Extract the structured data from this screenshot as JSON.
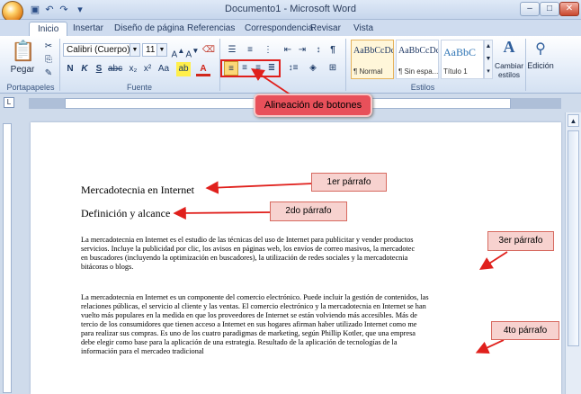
{
  "window": {
    "title": "Documento1 - Microsoft Word"
  },
  "tabs": [
    "Inicio",
    "Insertar",
    "Diseño de página",
    "Referencias",
    "Correspondencia",
    "Revisar",
    "Vista"
  ],
  "ribbon": {
    "clipboard": {
      "label": "Portapapeles",
      "paste_label": "Pegar"
    },
    "font": {
      "label": "Fuente",
      "font_name": "Calibri (Cuerpo)",
      "font_size": "11"
    },
    "paragraph": {
      "label": ""
    },
    "styles": {
      "label": "Estilos",
      "items": [
        {
          "preview": "AaBbCcDc",
          "name": "¶ Normal"
        },
        {
          "preview": "AaBbCcDc",
          "name": "¶ Sin espa..."
        },
        {
          "preview": "AaBbC",
          "name": "Título 1"
        }
      ],
      "change_styles_label": "Cambiar estilos",
      "editing_label": "Edición"
    }
  },
  "annotations": {
    "alignment": "Alineación de botones",
    "p1": "1er párrafo",
    "p2": "2do párrafo",
    "p3": "3er párrafo",
    "p4": "4to párrafo"
  },
  "document": {
    "heading1": "Mercadotecnia en Internet",
    "heading2": "Definición y alcance",
    "para3_lines": [
      "La mercadotecnia en Internet es el estudio de las técnicas del uso de Internet para publicitar y vender productos",
      "servicios. Incluye la publicidad por clic, los avisos en páginas web, los envíos de correo masivos, la mercadotec",
      "en buscadores (incluyendo la optimización en buscadores), la utilización de redes sociales y la mercadotecnia",
      "bitácoras o blogs."
    ],
    "para4_lines": [
      "La mercadotecnia en Internet es un componente del comercio electrónico. Puede incluir la gestión de contenidos, las",
      "relaciones públicas, el servicio al cliente y las ventas. El comercio electrónico y la mercadotecnia en Internet se han",
      "vuelto más populares en la medida en que los proveedores de Internet se están volviendo más accesibles. Más de",
      "tercio de los consumidores que tienen acceso a Internet en sus hogares afirman haber utilizado Internet como me",
      "para realizar sus compras. Es uno de los cuatro paradigmas de marketing, según Phillip Kotler, que una empresa",
      "debe elegir como base para la aplicación de una estrategia. Resultado de la aplicación de tecnologías de la",
      "información para el mercadeo tradicional"
    ]
  },
  "colors": {
    "accent_red": "#e8505a",
    "callout_fill": "#f7d2cf",
    "arrow": "#e0201c"
  }
}
